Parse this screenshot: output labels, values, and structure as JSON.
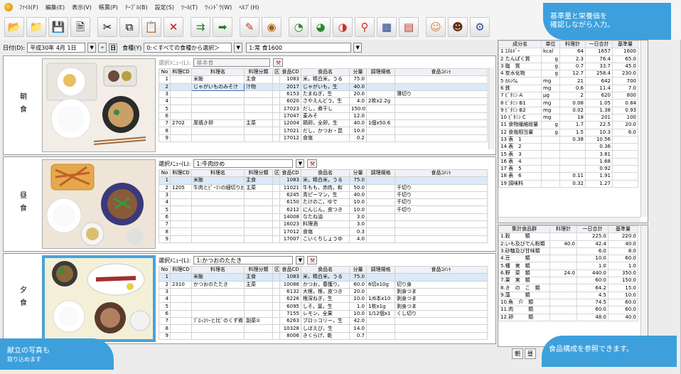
{
  "menu": [
    "ﾌｧｲﾙ(F)",
    "編集(E)",
    "表示(V)",
    "帳票(P)",
    "ﾃｰﾌﾞﾙ(B)",
    "設定(S)",
    "ﾂｰﾙ(T)",
    "ｳｨﾝﾄﾞｳ(W)",
    "ﾍﾙﾌﾟ(H)"
  ],
  "toolbar_icons": [
    "open-folder-icon",
    "open-file-icon",
    "save-icon",
    "print-icon",
    "cut-icon",
    "copy-icon",
    "paste-icon",
    "delete-icon",
    "export-icon",
    "import-icon",
    "recipe-icon",
    "dish-icon",
    "ingredient-icon",
    "nutrition-icon",
    "food-icon",
    "search-icon",
    "table-icon",
    "chart-icon",
    "user-icon",
    "group-icon",
    "tools-icon"
  ],
  "datebar": {
    "date_label": "日付(D):",
    "date_value": "平成30年 4月 1日",
    "day_icon": "日",
    "shokushu_label": "食種(Y)",
    "shokushu_value": "0:＜すべての食種から選択＞",
    "class_value": "1:常 食1600"
  },
  "headers": [
    "No",
    "料理CD",
    "料理名",
    "料理分類",
    "区",
    "食品CD",
    "食品名",
    "分量",
    "調理規格",
    "食品ｺﾒﾝﾄ"
  ],
  "meals": [
    {
      "label": "朝食",
      "menu_label": "選択ﾒﾆｭｰ(L):",
      "menu_value": "基本食",
      "rows": [
        [
          "1",
          "",
          "米飯",
          "主食",
          "",
          "1083",
          "米，精白米，うる",
          "75.0",
          "",
          ""
        ],
        [
          "2",
          "",
          "じゃがいものみそ汁",
          "汁物",
          "",
          "2017",
          "じゃがいも，生",
          "40.0",
          "",
          ""
        ],
        [
          "3",
          "",
          "",
          "",
          "",
          "6153",
          "たまねぎ，生",
          "20.0",
          "",
          "薄切り"
        ],
        [
          "4",
          "",
          "",
          "",
          "",
          "6020",
          "さやえんどう，生",
          "4.0",
          "2枚x2.2g",
          ""
        ],
        [
          "5",
          "",
          "",
          "",
          "",
          "17023",
          "だし，煮干し",
          "150.0",
          "",
          ""
        ],
        [
          "6",
          "",
          "",
          "",
          "",
          "17047",
          "麦みそ",
          "12.0",
          "",
          ""
        ],
        [
          "7",
          "2702",
          "厚焼き卵",
          "主菜",
          "",
          "12004",
          "鶏卵，全卵，生",
          "40.0",
          "1個x50.6",
          ""
        ],
        [
          "8",
          "",
          "",
          "",
          "",
          "17021",
          "だし，かつお・昆",
          "10.0",
          "",
          ""
        ],
        [
          "9",
          "",
          "",
          "",
          "",
          "17012",
          "食塩",
          "0.2",
          "",
          ""
        ]
      ]
    },
    {
      "label": "昼食",
      "menu_label": "選択ﾒﾆｭｰ(L):",
      "menu_value": "1:牛肉炒め",
      "rows": [
        [
          "1",
          "",
          "米飯",
          "主食",
          "",
          "1083",
          "米，精白米，うる",
          "75.0",
          "",
          ""
        ],
        [
          "2",
          "1205",
          "牛肉とﾋﾟｰﾏﾝの細切り炒め",
          "主菜",
          "",
          "11021",
          "牛もも，赤肉，和",
          "50.0",
          "",
          "千切り"
        ],
        [
          "3",
          "",
          "",
          "",
          "",
          "6245",
          "青ピーマン，生",
          "40.0",
          "",
          "千切り"
        ],
        [
          "4",
          "",
          "",
          "",
          "",
          "6150",
          "たけのこ，ゆで",
          "10.0",
          "",
          "千切り"
        ],
        [
          "5",
          "",
          "",
          "",
          "",
          "6212",
          "にんじん，皮つき",
          "10.0",
          "",
          "千切り"
        ],
        [
          "6",
          "",
          "",
          "",
          "",
          "14008",
          "なたね油",
          "3.0",
          "",
          ""
        ],
        [
          "7",
          "",
          "",
          "",
          "",
          "16023",
          "料理酒",
          "3.0",
          "",
          ""
        ],
        [
          "8",
          "",
          "",
          "",
          "",
          "17012",
          "食塩",
          "0.3",
          "",
          ""
        ],
        [
          "9",
          "",
          "",
          "",
          "",
          "17007",
          "こいくちしょうゆ",
          "4.0",
          "",
          ""
        ]
      ]
    },
    {
      "label": "夕食",
      "menu_label": "選択ﾒﾆｭｰ(L):",
      "menu_value": "1:かつおのたたき",
      "rows": [
        [
          "1",
          "",
          "米飯",
          "主食",
          "",
          "1083",
          "米，精白米，うる",
          "75.0",
          "",
          ""
        ],
        [
          "2",
          "2310",
          "かつおのたたき",
          "主菜",
          "",
          "10086",
          "かつお，春獲り，",
          "60.0",
          "6切x10g",
          "切り身"
        ],
        [
          "3",
          "",
          "",
          "",
          "",
          "6132",
          "大根，根，皮つき",
          "20.0",
          "",
          "剥身つま"
        ],
        [
          "4",
          "",
          "",
          "",
          "",
          "6226",
          "根深ねぎ，生",
          "10.0",
          "1/6本x10",
          "剥身つま"
        ],
        [
          "5",
          "",
          "",
          "",
          "",
          "6095",
          "しそ，葉，生",
          "1.0",
          "1枚x1g",
          "剥身つま"
        ],
        [
          "6",
          "",
          "",
          "",
          "",
          "7155",
          "レモン，全果",
          "10.0",
          "1/12個x1",
          "くし切り"
        ],
        [
          "7",
          "",
          "ﾌﾞﾛｯｺﾘｰと比ﾞのくず煮",
          "副菜①",
          "",
          "6263",
          "ブロッコリー，生",
          "42.0",
          "",
          ""
        ],
        [
          "8",
          "",
          "",
          "",
          "",
          "10328",
          "しばえび，生",
          "14.0",
          "",
          ""
        ],
        [
          "9",
          "",
          "",
          "",
          "",
          "8006",
          "きくらげ，乾",
          "0.7",
          "",
          ""
        ]
      ]
    }
  ],
  "nutrition": {
    "headers": [
      "成分名",
      "単位",
      "料理計",
      "一日合計",
      "基準量"
    ],
    "rows": [
      [
        "1 ｴﾈﾙｷﾞｰ",
        "kcal",
        "64",
        "1657",
        "1600"
      ],
      [
        "2 たんぱく質",
        "g",
        "2.3",
        "76.4",
        "65.0"
      ],
      [
        "3 脂　質",
        "g",
        "0.7",
        "33.7",
        "45.0"
      ],
      [
        "4 炭水化物",
        "g",
        "12.7",
        "258.4",
        "230.0"
      ],
      [
        "5 ｶﾙｼｳﾑ",
        "mg",
        "21",
        "642",
        "700"
      ],
      [
        "6 鉄",
        "mg",
        "0.6",
        "11.4",
        "7.0"
      ],
      [
        "7 ﾋﾞﾀﾐﾝ A",
        "μg",
        "2",
        "620",
        "800"
      ],
      [
        "8 ﾋﾞﾀﾐﾝ B1",
        "mg",
        "0.08",
        "1.05",
        "0.84"
      ],
      [
        "9 ﾋﾞﾀﾐﾝ B2",
        "mg",
        "0.02",
        "1.38",
        "0.93"
      ],
      [
        "10 ﾋﾞﾀﾐﾝ C",
        "mg",
        "18",
        "201",
        "100"
      ],
      [
        "11 食物繊維総量",
        "g",
        "1.7",
        "22.5",
        "20.0"
      ],
      [
        "12 食塩相当量",
        "g",
        "1.5",
        "10.3",
        "6.0"
      ],
      [
        "13 表　1",
        "",
        "0.38",
        "10.56",
        ""
      ],
      [
        "14 表　2",
        "",
        "",
        "0.36",
        ""
      ],
      [
        "15 表　3",
        "",
        "",
        "3.81",
        ""
      ],
      [
        "16 表　4",
        "",
        "",
        "1.68",
        ""
      ],
      [
        "17 表　5",
        "",
        "",
        "0.92",
        ""
      ],
      [
        "18 表　6",
        "",
        "0.11",
        "1.91",
        ""
      ],
      [
        "19 調味料",
        "",
        "0.32",
        "1.27",
        ""
      ]
    ]
  },
  "groups": {
    "headers": [
      "集計食品群",
      "料理計",
      "一日合計",
      "基準量"
    ],
    "rows": [
      [
        "1.穀　　　類",
        "",
        "225.0",
        "220.0"
      ],
      [
        "2.いも及びでん粉類",
        "40.0",
        "42.4",
        "40.0"
      ],
      [
        "3.砂糖及び甘味類",
        "",
        "6.0",
        "8.0"
      ],
      [
        "4.豆　　　類",
        "",
        "10.0",
        "60.0"
      ],
      [
        "5.種　実　類",
        "",
        "1.0",
        "1.0"
      ],
      [
        "6.野　菜　類",
        "24.0",
        "440.0",
        "350.0"
      ],
      [
        "7.果　実　類",
        "",
        "60.0",
        "150.0"
      ],
      [
        "8.き　の　こ　類",
        "",
        "64.2",
        "15.0"
      ],
      [
        "9.藻　　　類",
        "",
        "4.5",
        "10.0"
      ],
      [
        "10.魚　介　類",
        "",
        "74.5",
        "60.0"
      ],
      [
        "11.肉　　　類",
        "",
        "60.0",
        "60.0"
      ],
      [
        "12.卵　　　類",
        "",
        "48.0",
        "40.0"
      ]
    ]
  },
  "callouts": {
    "top_right_l1": "基準量と栄養価を",
    "top_right_l2": "確認しながら入力。",
    "bottom_left_l1": "献立の写真も",
    "bottom_left_l2": "取り込めます",
    "bottom_right": "食品構成を参照できます。"
  },
  "tabs": [
    "朝",
    "昼"
  ]
}
